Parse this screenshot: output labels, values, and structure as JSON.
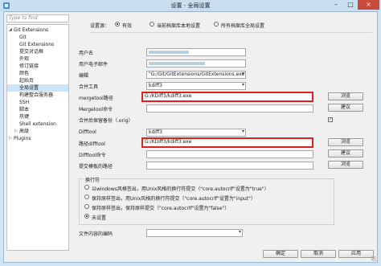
{
  "window": {
    "title": "设置 - 全局设置",
    "min_icon": "minimize-icon",
    "max_icon": "maximize-icon",
    "close_icon": "close-icon"
  },
  "filter": {
    "placeholder": "Type to find"
  },
  "tree": {
    "items": [
      {
        "label": "Git Extensions",
        "expanded": true,
        "level": 0
      },
      {
        "label": "Git",
        "level": 1
      },
      {
        "label": "Git Extensions",
        "level": 1
      },
      {
        "label": "提交对话框",
        "level": 1
      },
      {
        "label": "外观",
        "level": 1
      },
      {
        "label": "修订链接",
        "level": 1
      },
      {
        "label": "颜色",
        "level": 1
      },
      {
        "label": "起始页",
        "level": 1
      },
      {
        "label": "全局设置",
        "level": 1,
        "selected": true
      },
      {
        "label": "构建整合服务器",
        "level": 1
      },
      {
        "label": "SSH",
        "level": 1
      },
      {
        "label": "脚本",
        "level": 1
      },
      {
        "label": "热键",
        "level": 1
      },
      {
        "label": "Shell extension",
        "level": 1
      },
      {
        "label": "高级",
        "level": 1,
        "expanded": false
      },
      {
        "label": "Plugins",
        "level": 0,
        "expanded": false
      }
    ]
  },
  "scope": {
    "label": "设置源：",
    "options": [
      {
        "label": "有效",
        "selected": true
      },
      {
        "label": "当前档案库本地设置",
        "selected": false
      },
      {
        "label": "所有档案库全局设置",
        "selected": false
      }
    ]
  },
  "form": {
    "user_name_label": "用户名",
    "user_email_label": "用户电子邮件",
    "editor_label": "编辑",
    "editor_value": "\"G:/Git/GitExtensions/GitExtensions.exe\" filee",
    "mergetool_label": "合并工具",
    "mergetool_value": "kdiff3",
    "mergetool_path_label": "mergetool路径",
    "mergetool_path_value": "G:/KDiff3/kdiff3.exe",
    "mergetool_cmd_label": "Mergetool命令",
    "keep_backup_label": "合并后保留备份（.orig）",
    "keep_backup_checked": true,
    "difftool_label": "Difftool",
    "difftool_value": "kdiff3",
    "difftool_path_label": "路径difftool",
    "difftool_path_value": "G:/KDiff3/kdiff3.exe",
    "difftool_cmd_label": "Difftool命令",
    "commit_template_label": "提交模板的路径",
    "browse_label": "浏览",
    "suggest_label": "建议"
  },
  "line_endings": {
    "title": "换行符",
    "options": [
      {
        "label": "以windows风格签出，用Unix风格的换行符提交（\"core.autocrlf\"设置为\"true\"）",
        "selected": false
      },
      {
        "label": "保持原样签出，用Unix风格的换行符提交（\"core.autocrlf\"设置为\"input\"）",
        "selected": false
      },
      {
        "label": "保持原样签出，保持原样提交（\"core.autocrlf\"设置为\"false\"）",
        "selected": false
      },
      {
        "label": "未设置",
        "selected": true
      }
    ]
  },
  "encoding": {
    "label": "文件内容的编码"
  },
  "footer": {
    "ok": "确定",
    "cancel": "取消",
    "apply": "应用"
  },
  "colors": {
    "highlight_border": "#d9231f",
    "selected_tree_item": "#cce4f7"
  }
}
